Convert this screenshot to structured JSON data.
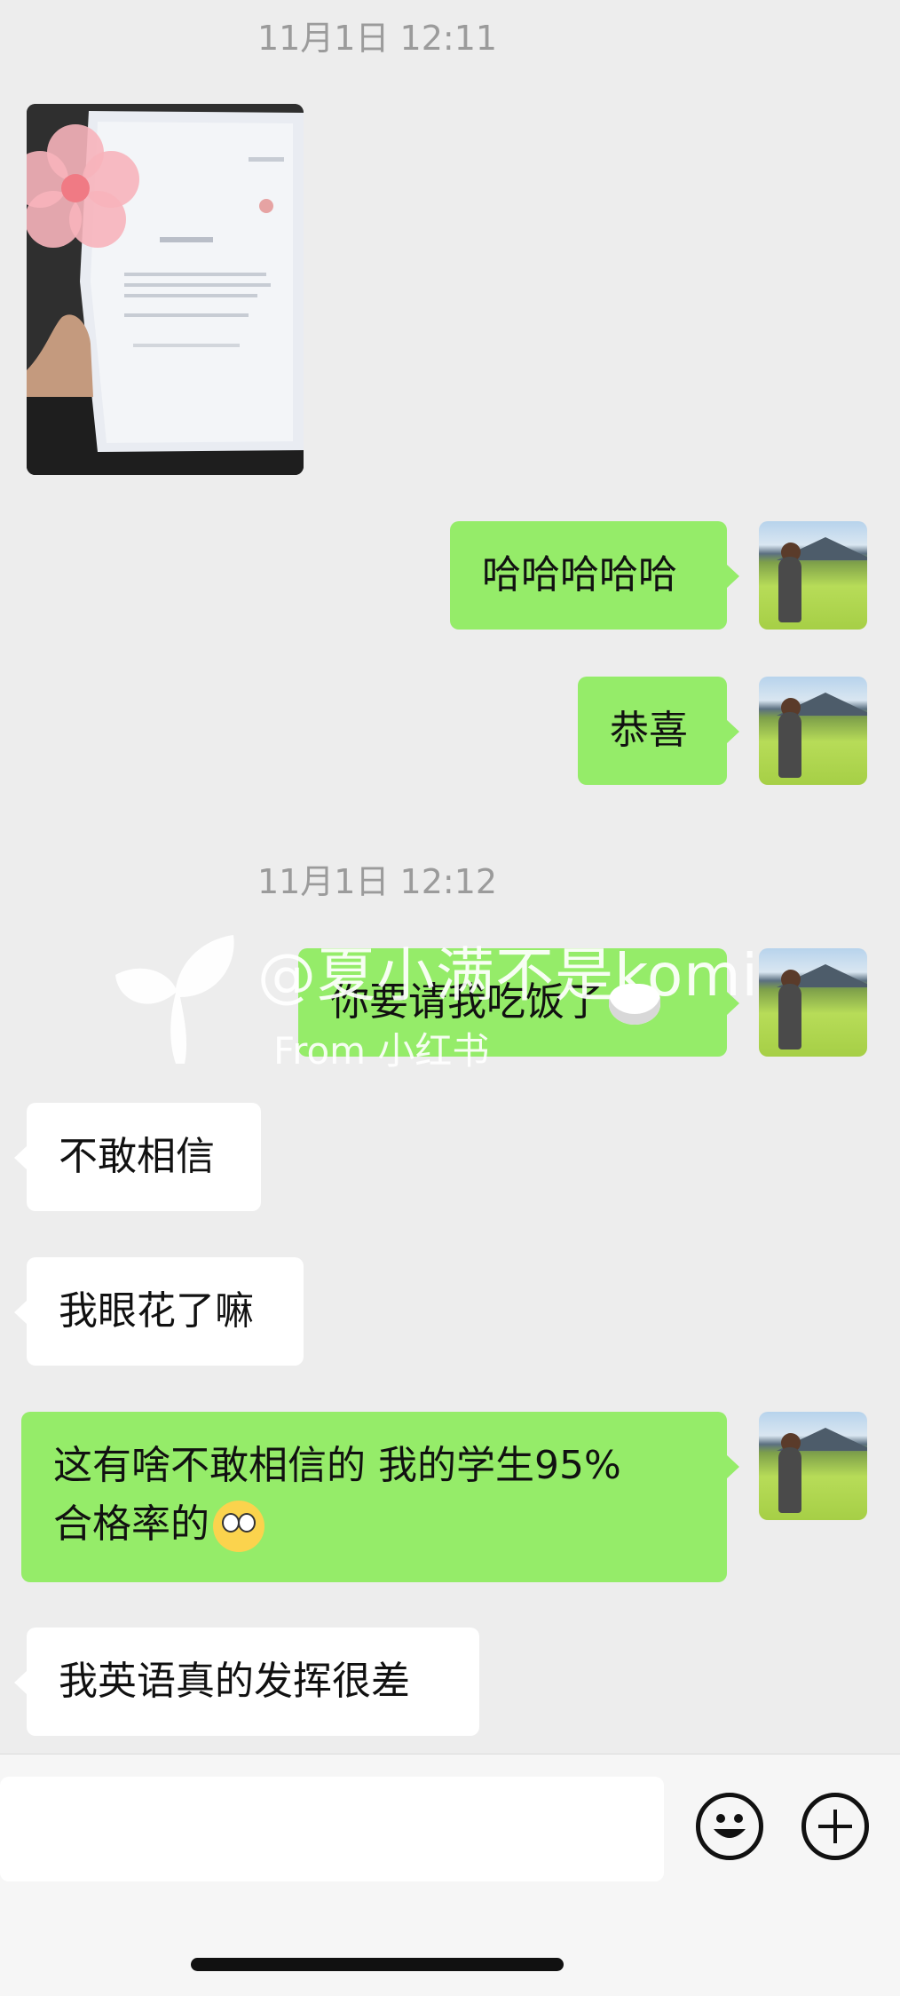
{
  "chat": {
    "timestamps": [
      "11月1日 12:11",
      "11月1日 12:12"
    ],
    "messages": [
      {
        "side": "left",
        "type": "image",
        "description": "photo"
      },
      {
        "side": "right",
        "text": "哈哈哈哈哈"
      },
      {
        "side": "right",
        "text": "恭喜"
      },
      {
        "side": "right",
        "text": "你要请我吃饭了"
      },
      {
        "side": "left",
        "text": "不敢相信"
      },
      {
        "side": "left",
        "text": "我眼花了嘛"
      },
      {
        "side": "right",
        "line1": "这有啥不敢相信的 我的学生95%",
        "line2": "合格率的"
      },
      {
        "side": "left",
        "text": "我英语真的发挥很差"
      }
    ]
  },
  "watermark": {
    "handle": "@夏小满不是komi",
    "from": "From 小红书"
  },
  "colors": {
    "sent_bubble": "#95ec69",
    "received_bubble": "#ffffff",
    "background": "#ededed"
  },
  "icons": [
    "emoji-icon",
    "plus-icon"
  ]
}
